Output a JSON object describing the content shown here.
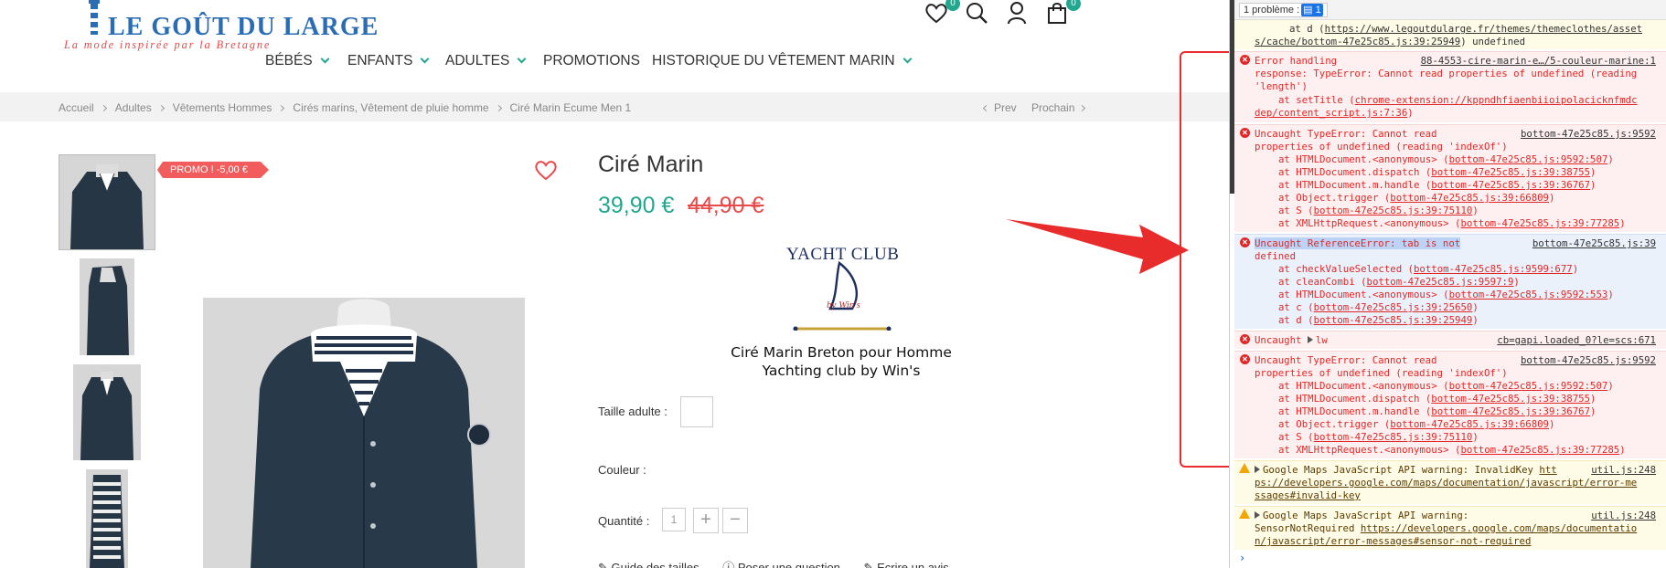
{
  "brand": {
    "name": "LE GOÛT DU LARGE",
    "tagline": "La mode inspirée par la Bretagne"
  },
  "header": {
    "wishlist_count": "0",
    "cart_count": "0"
  },
  "nav": [
    {
      "label": "BÉBÉS",
      "dropdown": true
    },
    {
      "label": "ENFANTS",
      "dropdown": true
    },
    {
      "label": "ADULTES",
      "dropdown": true
    },
    {
      "label": "PROMOTIONS",
      "dropdown": false
    },
    {
      "label": "HISTORIQUE DU VÊTEMENT MARIN",
      "dropdown": true
    }
  ],
  "breadcrumb": [
    "Accueil",
    "Adultes",
    "Vêtements Hommes",
    "Cirés marins, Vêtement de pluie homme",
    "Ciré Marin Ecume Men 1"
  ],
  "pager": {
    "prev": "Prev",
    "next": "Prochain"
  },
  "product": {
    "promo_badge": "PROMO ! -5,00 €",
    "title": "Ciré Marin",
    "price": "39,90 €",
    "old_price": "44,90 €",
    "brand_logo_text": "YACHT CLUB",
    "brand_logo_sub": "by Win's",
    "description_line1": "Ciré Marin Breton pour Homme",
    "description_line2": "Yachting club by Win's",
    "size_label": "Taille adulte :",
    "color_label": "Couleur :",
    "qty_label": "Quantité :",
    "qty_value": "1",
    "qty_plus": "+",
    "qty_minus": "−",
    "link_size_guide": "Guide des tailles",
    "link_question": "Poser une question",
    "link_review": "Ecrire un avis"
  },
  "colors": {
    "accent": "#21a88f",
    "sale": "#e84a4a",
    "brand_blue": "#2a6db5",
    "error": "#e02828",
    "warning": "#f2a600"
  },
  "console": {
    "issues_label": "1 problème :",
    "issues_count": "1",
    "top": {
      "line1": "at d (",
      "link1": "https://www.legoutdularge.fr/themes/themeclothes/asset",
      "link2": "s/cache/bottom-47e25c85.js:39:25949",
      "tail": ") undefined"
    },
    "e1": {
      "l1": "Error handling",
      "l2": "response: TypeError: Cannot read properties of undefined (reading",
      "l3": "'length')",
      "src": "88-4553-cire-marin-e…/5-couleur-marine:1",
      "st1_pre": "at setTitle (",
      "st1_link": "chrome-extension://kppndhfiaenbiioipolacicknfmdc",
      "st2_link": "dep/content_script.js:7:36",
      "st2_tail": ")"
    },
    "e2": {
      "l1": "Uncaught TypeError: Cannot read",
      "l2": "properties of undefined (reading 'indexOf')",
      "src": "bottom-47e25c85.js:9592",
      "stack": [
        {
          "fn": "at HTMLDocument.<anonymous> (",
          "loc": "bottom-47e25c85.js:9592:507"
        },
        {
          "fn": "at HTMLDocument.dispatch (",
          "loc": "bottom-47e25c85.js:39:38755"
        },
        {
          "fn": "at HTMLDocument.m.handle (",
          "loc": "bottom-47e25c85.js:39:36767"
        },
        {
          "fn": "at Object.trigger (",
          "loc": "bottom-47e25c85.js:39:66809"
        },
        {
          "fn": "at S (",
          "loc": "bottom-47e25c85.js:39:75110"
        },
        {
          "fn": "at XMLHttpRequest.<anonymous> (",
          "loc": "bottom-47e25c85.js:39:77285"
        }
      ]
    },
    "e3": {
      "l1": "Uncaught ReferenceError: tab is not",
      "l2": "defined",
      "src": "bottom-47e25c85.js:39",
      "stack": [
        {
          "fn": "at checkValueSelected (",
          "loc": "bottom-47e25c85.js:9599:677"
        },
        {
          "fn": "at cleanCombi (",
          "loc": "bottom-47e25c85.js:9597:9"
        },
        {
          "fn": "at HTMLDocument.<anonymous> (",
          "loc": "bottom-47e25c85.js:9592:553"
        },
        {
          "fn": "at c (",
          "loc": "bottom-47e25c85.js:39:25650"
        },
        {
          "fn": "at d (",
          "loc": "bottom-47e25c85.js:39:25949"
        }
      ]
    },
    "e4": {
      "l1": "Uncaught",
      "obj": "lw",
      "src": "cb=gapi.loaded_0?le=scs:671"
    },
    "e5": {
      "l1": "Uncaught TypeError: Cannot read",
      "l2": "properties of undefined (reading 'indexOf')",
      "src": "bottom-47e25c85.js:9592",
      "stack": [
        {
          "fn": "at HTMLDocument.<anonymous> (",
          "loc": "bottom-47e25c85.js:9592:507"
        },
        {
          "fn": "at HTMLDocument.dispatch (",
          "loc": "bottom-47e25c85.js:39:38755"
        },
        {
          "fn": "at HTMLDocument.m.handle (",
          "loc": "bottom-47e25c85.js:39:36767"
        },
        {
          "fn": "at Object.trigger (",
          "loc": "bottom-47e25c85.js:39:66809"
        },
        {
          "fn": "at S (",
          "loc": "bottom-47e25c85.js:39:75110"
        },
        {
          "fn": "at XMLHttpRequest.<anonymous> (",
          "loc": "bottom-47e25c85.js:39:77285"
        }
      ]
    },
    "w1": {
      "l1": "Google Maps JavaScript API warning: InvalidKey",
      "l1_link": "htt",
      "src": "util.js:248",
      "l2": "ps://developers.google.com/maps/documentation/javascript/error-me",
      "l3": "ssages#invalid-key"
    },
    "w2": {
      "l1": "Google Maps JavaScript API warning:",
      "src": "util.js:248",
      "l2_pre": "SensorNotRequired",
      "l2_link": "https://developers.google.com/maps/documentatio",
      "l3": "n/javascript/error-messages#sensor-not-required"
    },
    "prompt": "›"
  }
}
